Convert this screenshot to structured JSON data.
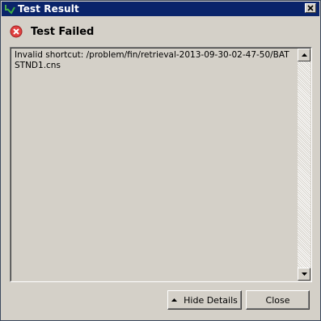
{
  "window": {
    "title": "Test Result",
    "icon": "green-test-arrow-icon"
  },
  "header": {
    "status_icon": "error-circle-icon",
    "status_text": "Test Failed",
    "status_color": "#e04040"
  },
  "details": {
    "message": "Invalid shortcut: /problem/fin/retrieval-2013-09-30-02-47-50/BATSTND1.cns"
  },
  "buttons": {
    "hide_details_label": "Hide Details",
    "hide_details_icon": "triangle-up-icon",
    "close_label": "Close"
  },
  "colors": {
    "titlebar": "#0a246a",
    "dialog_bg": "#d4d0c8"
  }
}
